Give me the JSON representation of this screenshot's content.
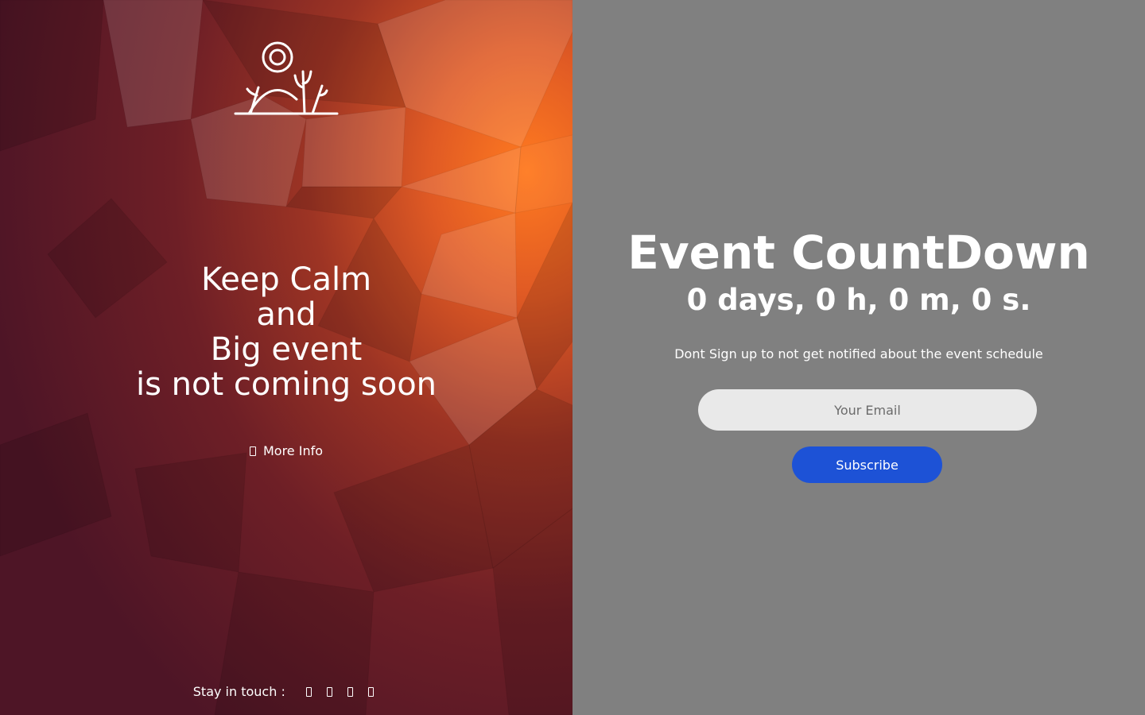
{
  "colors": {
    "left_base": "#5a1a26",
    "left_accent": "#ff7a20",
    "right_background": "#808080",
    "input_background": "#e9e9e9",
    "button_blue": "#1d52d6",
    "text": "#ffffff"
  },
  "left": {
    "logo_icon": "desert-sun-cactus-icon",
    "headline": {
      "line1": "Keep Calm",
      "line2": "and",
      "line3": "Big event",
      "line4": "is not coming soon"
    },
    "more_info": {
      "icon": "info-icon",
      "label": "More Info"
    },
    "social": {
      "label": "Stay in touch :",
      "icons": [
        "facebook-icon",
        "twitter-icon",
        "instagram-icon",
        "pinterest-icon"
      ]
    }
  },
  "right": {
    "title": "Event CountDown",
    "countdown": "0 days, 0 h, 0 m, 0 s.",
    "description": "Dont Sign up to not get notified about the event schedule",
    "email_placeholder": "Your Email",
    "email_value": "",
    "subscribe_label": "Subscribe"
  }
}
